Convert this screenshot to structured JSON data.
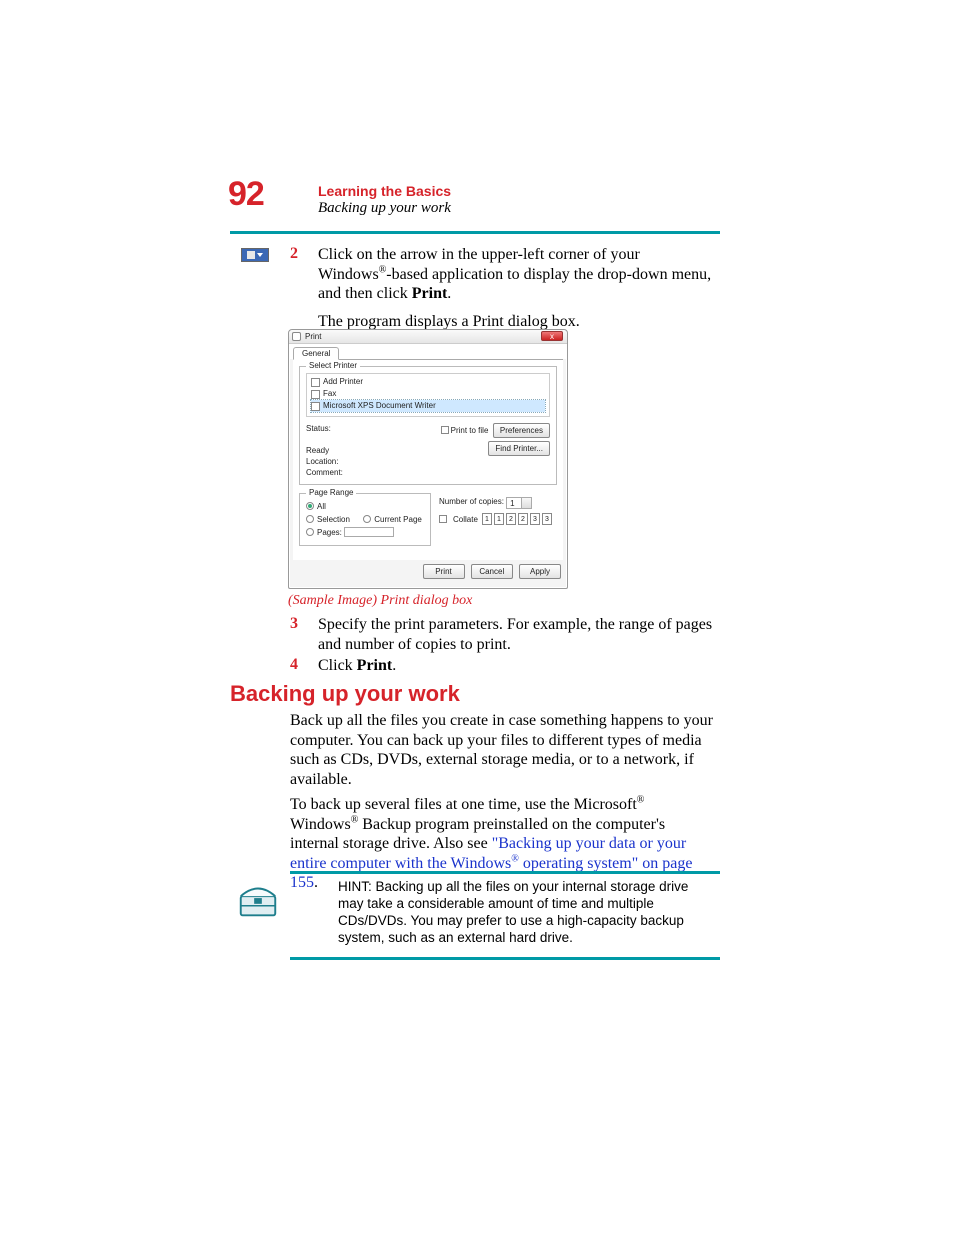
{
  "page_number": "92",
  "header": {
    "chapter": "Learning the Basics",
    "section": "Backing up your work"
  },
  "steps": {
    "s2": {
      "num": "2",
      "text_a": "Click on the arrow in the upper-left corner of your Windows",
      "sup_a": "®",
      "text_b": "-based application to display the drop-down menu, and then click ",
      "bold_b": "Print",
      "text_c": ".",
      "after": "The program displays a Print dialog box."
    },
    "s3": {
      "num": "3",
      "text": "Specify the print parameters. For example, the range of pages and number of copies to print."
    },
    "s4": {
      "num": "4",
      "text_a": "Click ",
      "bold": "Print",
      "text_b": "."
    }
  },
  "figure_caption": "(Sample Image) Print dialog box",
  "dialog": {
    "title": "Print",
    "tab_general": "General",
    "group_select_printer": "Select Printer",
    "printer_add": "Add Printer",
    "printer_fax": "Fax",
    "printer_xps": "Microsoft XPS Document Writer",
    "label_status": "Status:",
    "value_status": "Ready",
    "label_location": "Location:",
    "label_comment": "Comment:",
    "chk_print_to_file": "Print to file",
    "btn_preferences": "Preferences",
    "btn_find_printer": "Find Printer...",
    "group_page_range": "Page Range",
    "radio_all": "All",
    "radio_selection": "Selection",
    "radio_current": "Current Page",
    "radio_pages": "Pages:",
    "label_copies": "Number of copies:",
    "value_copies": "1",
    "chk_collate": "Collate",
    "collate_pages": [
      "1",
      "1",
      "2",
      "2",
      "3",
      "3"
    ],
    "btn_print": "Print",
    "btn_cancel": "Cancel",
    "btn_apply": "Apply"
  },
  "heading2": "Backing up your work",
  "para1": "Back up all the files you create in case something happens to your computer. You can back up your files to different types of media such as CDs, DVDs, external storage media, or to a network, if available.",
  "para2_a": "To back up several files at one time, use the Microsoft",
  "para2_sup1": "®",
  "para2_b": " Windows",
  "para2_sup2": "®",
  "para2_c": " Backup program preinstalled on the computer's internal storage drive. Also see ",
  "para2_link_a": "\"Backing up your data or your entire computer with the Windows",
  "para2_link_sup": "®",
  "para2_link_b": " operating system\" on page 155",
  "para2_d": ".",
  "hint": "HINT: Backing up all the files on your internal storage drive may take a considerable amount of time and multiple CDs/DVDs. You may prefer to use a high-capacity backup system, such as an external hard drive."
}
